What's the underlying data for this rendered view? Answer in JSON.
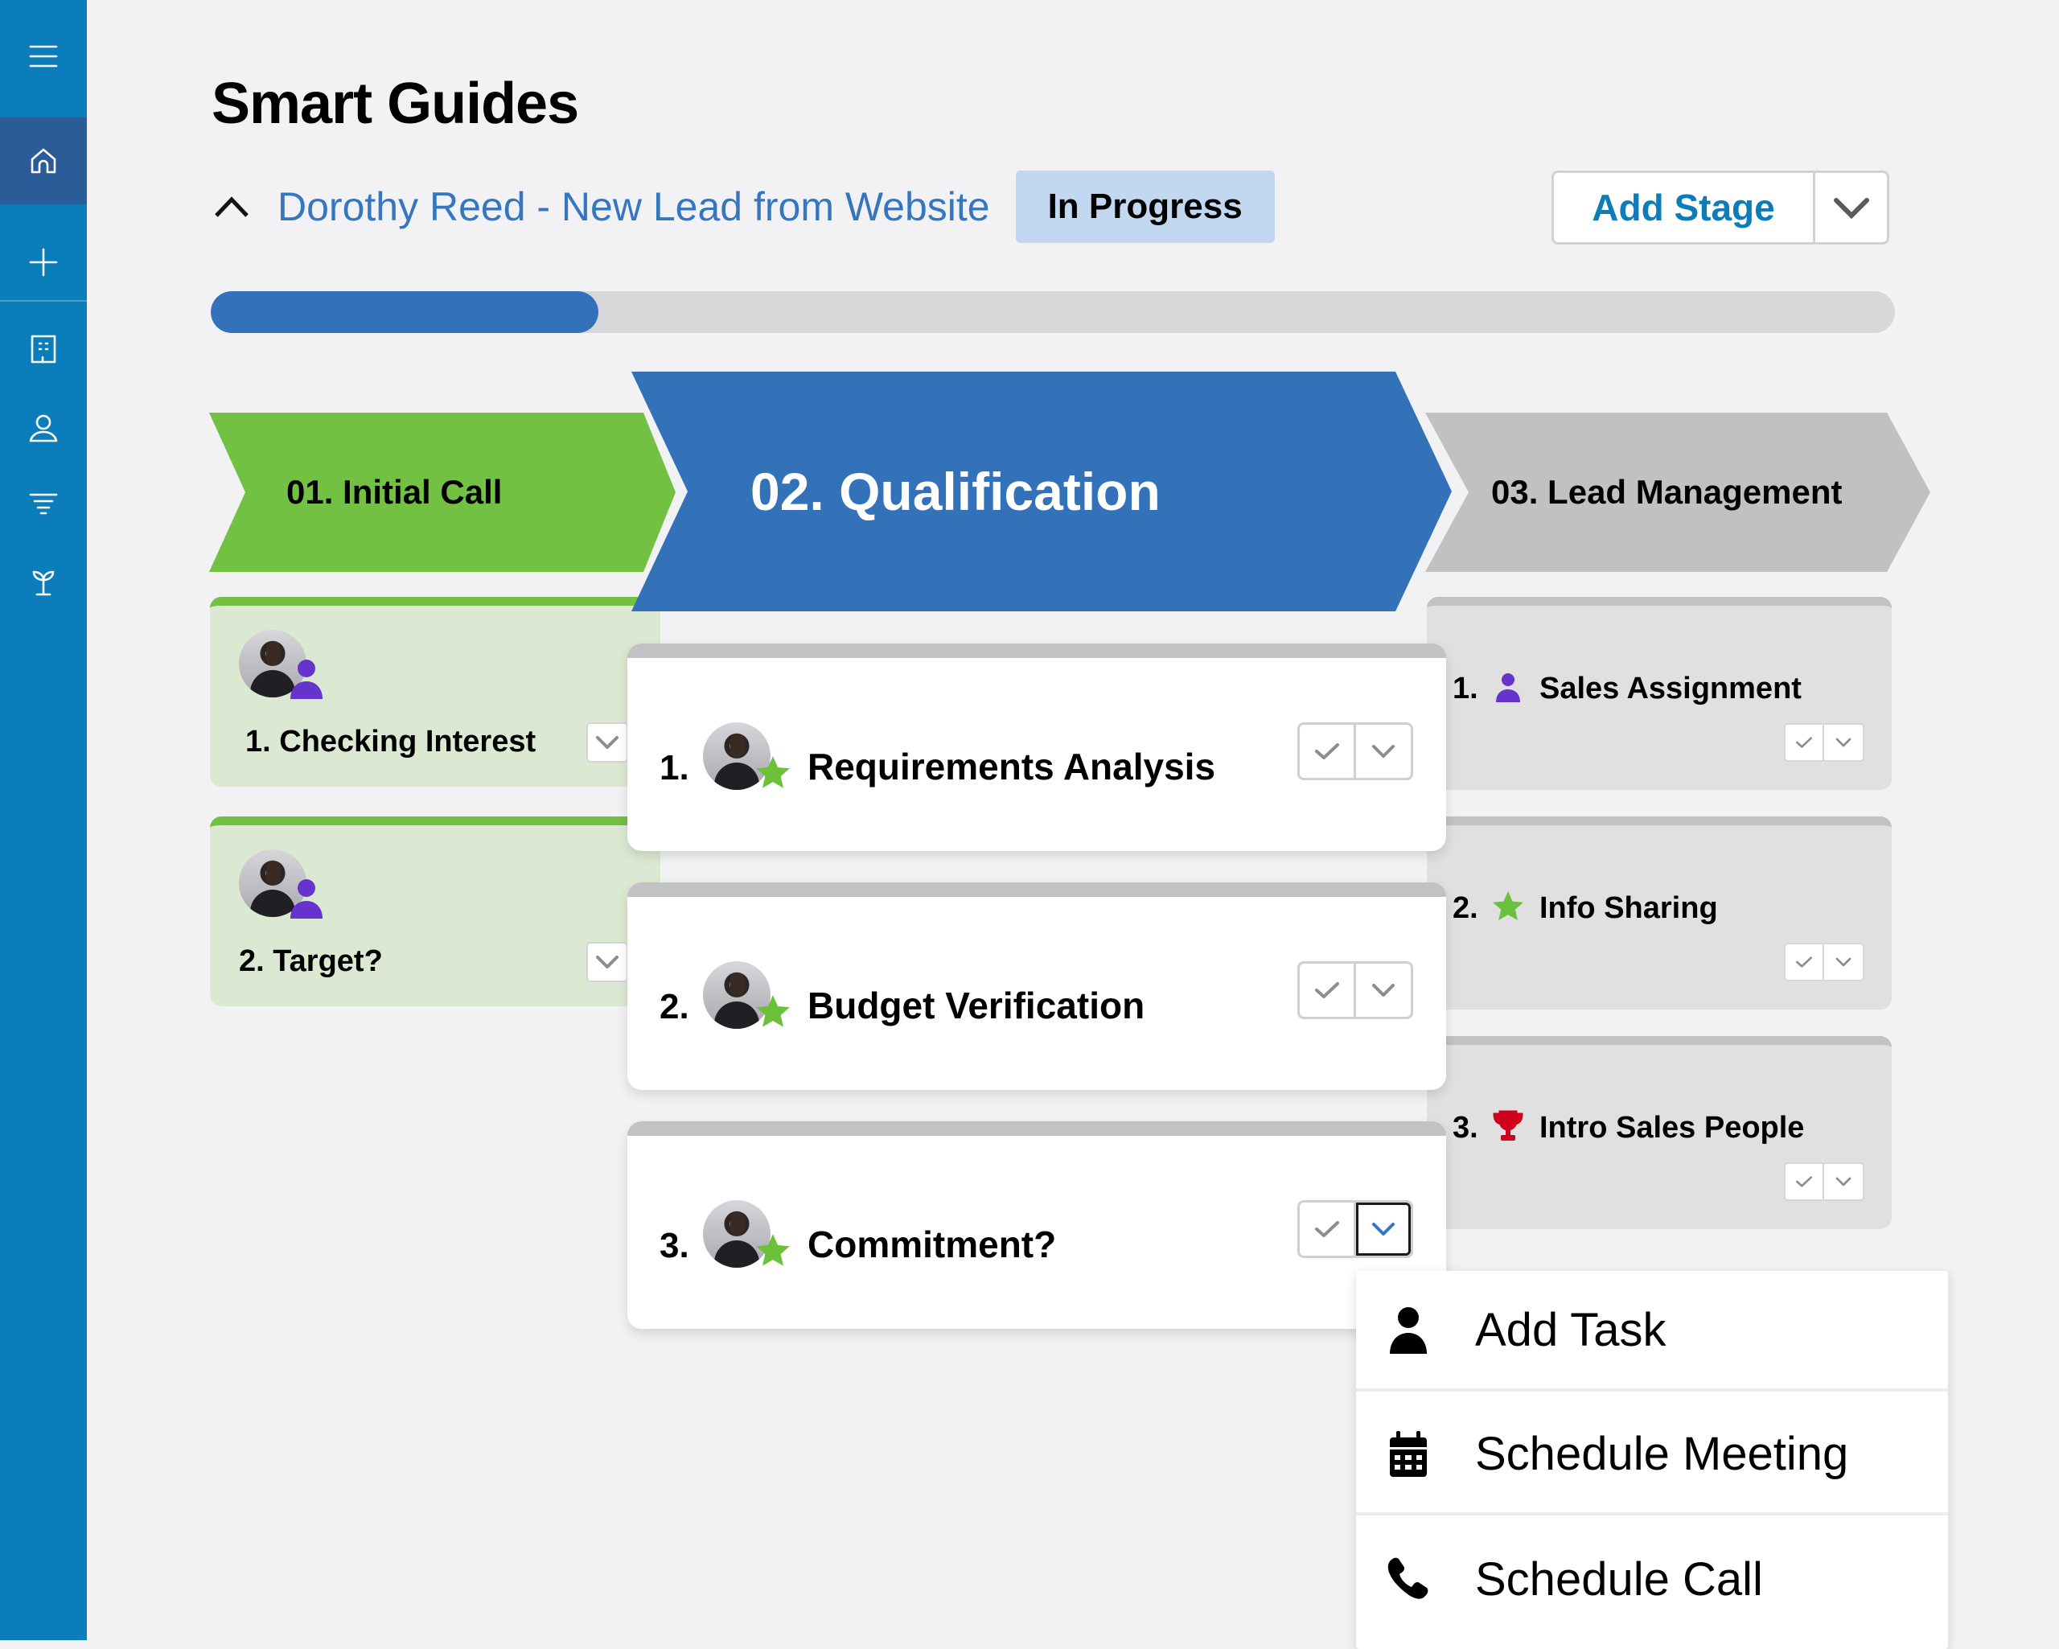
{
  "sidebar": {
    "items": [
      {
        "name": "menu",
        "icon": "hamburger-icon"
      },
      {
        "name": "home",
        "icon": "home-icon",
        "active": true
      },
      {
        "name": "add",
        "icon": "plus-icon"
      },
      {
        "name": "accounts",
        "icon": "building-icon"
      },
      {
        "name": "contacts",
        "icon": "person-icon"
      },
      {
        "name": "filter",
        "icon": "filter-icon"
      },
      {
        "name": "growth",
        "icon": "sprout-icon"
      }
    ]
  },
  "page": {
    "title": "Smart Guides"
  },
  "guide": {
    "name": "Dorothy Reed - New Lead from Website",
    "status": "In Progress",
    "collapse_icon": "chevron-up-icon",
    "progress_percent": 23
  },
  "toolbar": {
    "add_stage_label": "Add Stage",
    "add_stage_menu_icon": "chevron-down-icon"
  },
  "colors": {
    "sidebar": "#0b7dbb",
    "stage_done": "#72c142",
    "stage_active": "#3371b9",
    "stage_pending": "#c1c1c3",
    "link": "#3576c1",
    "status_badge": "#c2d7f0",
    "task_user_icon": "#6633cc",
    "task_star_icon": "#6cc13a",
    "task_trophy_icon": "#d0021b"
  },
  "stages": [
    {
      "label": "01. Initial Call",
      "state": "completed",
      "tasks": [
        {
          "number": "1.",
          "title": "Checking Interest",
          "badge": "user-icon"
        },
        {
          "number": "2.",
          "title": "Target?",
          "badge": "user-icon"
        }
      ]
    },
    {
      "label": "02. Qualification",
      "state": "active",
      "tasks": [
        {
          "number": "1.",
          "title": "Requirements Analysis",
          "badge": "star-icon"
        },
        {
          "number": "2.",
          "title": "Budget Verification",
          "badge": "star-icon"
        },
        {
          "number": "3.",
          "title": "Commitment?",
          "badge": "star-icon",
          "menu_open": true
        }
      ]
    },
    {
      "label": "03. Lead Management",
      "state": "pending",
      "tasks": [
        {
          "number": "1.",
          "title": "Sales Assignment",
          "icon": "user-icon"
        },
        {
          "number": "2.",
          "title": "Info Sharing",
          "icon": "star-icon"
        },
        {
          "number": "3.",
          "title": "Intro Sales People",
          "icon": "trophy-icon"
        }
      ]
    }
  ],
  "task_menu": {
    "items": [
      {
        "label": "Add Task",
        "icon": "person-icon"
      },
      {
        "label": "Schedule Meeting",
        "icon": "calendar-icon"
      },
      {
        "label": "Schedule Call",
        "icon": "phone-icon"
      }
    ]
  }
}
